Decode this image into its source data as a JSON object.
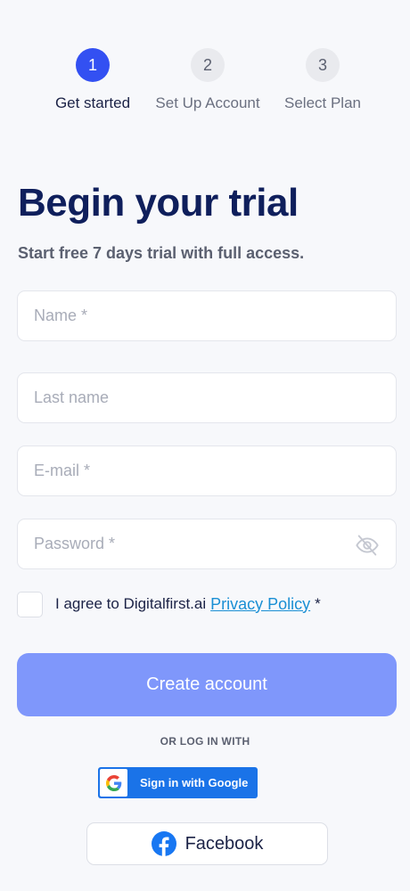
{
  "steps": [
    {
      "number": "1",
      "label": "Get started",
      "active": true
    },
    {
      "number": "2",
      "label": "Set Up Account",
      "active": false
    },
    {
      "number": "3",
      "label": "Select Plan",
      "active": false
    }
  ],
  "heading": {
    "title": "Begin your trial",
    "subtitle": "Start free 7 days trial with full access."
  },
  "form": {
    "name_placeholder": "Name *",
    "lastname_placeholder": "Last name",
    "email_placeholder": "E-mail *",
    "password_placeholder": "Password *",
    "agree_text": "I agree to Digitalfirst.ai",
    "policy_link": "Privacy Policy",
    "required_mark": "*",
    "create_label": "Create account"
  },
  "social": {
    "divider_text": "OR LOG IN WITH",
    "google_label": "Sign in with Google",
    "facebook_label": "Facebook"
  },
  "colors": {
    "accent": "#3350f2",
    "button_disabled": "#7f97fb",
    "title": "#0f1f5c",
    "link": "#1a8fd4",
    "google_blue": "#1a73e8",
    "facebook_blue": "#1877f2"
  },
  "icons": {
    "password_toggle": "eye-off-icon",
    "google": "google-icon",
    "facebook": "facebook-icon"
  }
}
